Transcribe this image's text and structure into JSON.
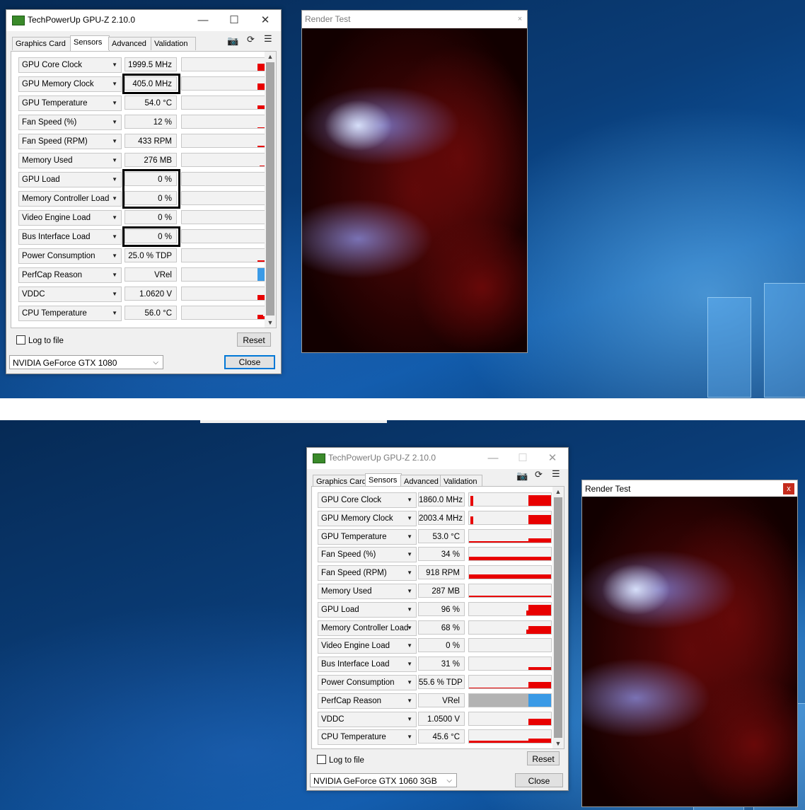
{
  "colors": {
    "graph_bar": "#e80000",
    "perfcap_vrel": "#3a9ae6",
    "perfcap_idle": "#b3b3b3",
    "highlight": "#000000"
  },
  "top": {
    "window_title": "TechPowerUp GPU-Z 2.10.0",
    "tabs": [
      "Graphics Card",
      "Sensors",
      "Advanced",
      "Validation"
    ],
    "active_tab": "Sensors",
    "sensors": [
      {
        "name": "GPU Core Clock",
        "value": "1999.5 MHz"
      },
      {
        "name": "GPU Memory Clock",
        "value": "405.0 MHz"
      },
      {
        "name": "GPU Temperature",
        "value": "54.0 °C"
      },
      {
        "name": "Fan Speed (%)",
        "value": "12 %"
      },
      {
        "name": "Fan Speed (RPM)",
        "value": "433 RPM"
      },
      {
        "name": "Memory Used",
        "value": "276 MB"
      },
      {
        "name": "GPU Load",
        "value": "0 %"
      },
      {
        "name": "Memory Controller Load",
        "value": "0 %"
      },
      {
        "name": "Video Engine Load",
        "value": "0 %"
      },
      {
        "name": "Bus Interface Load",
        "value": "0 %"
      },
      {
        "name": "Power Consumption",
        "value": "25.0 % TDP"
      },
      {
        "name": "PerfCap Reason",
        "value": "VRel"
      },
      {
        "name": "VDDC",
        "value": "1.0620 V"
      },
      {
        "name": "CPU Temperature",
        "value": "56.0 °C"
      }
    ],
    "log_to_file": "Log to file",
    "reset": "Reset",
    "gpu_select": "NVIDIA GeForce GTX 1080",
    "close": "Close",
    "render_title": "Render Test",
    "render_close": "×"
  },
  "bottom": {
    "window_title": "TechPowerUp GPU-Z 2.10.0",
    "tabs": [
      "Graphics Card",
      "Sensors",
      "Advanced",
      "Validation"
    ],
    "active_tab": "Sensors",
    "sensors": [
      {
        "name": "GPU Core Clock",
        "value": "1860.0 MHz"
      },
      {
        "name": "GPU Memory Clock",
        "value": "2003.4 MHz"
      },
      {
        "name": "GPU Temperature",
        "value": "53.0 °C"
      },
      {
        "name": "Fan Speed (%)",
        "value": "34 %"
      },
      {
        "name": "Fan Speed (RPM)",
        "value": "918 RPM"
      },
      {
        "name": "Memory Used",
        "value": "287 MB"
      },
      {
        "name": "GPU Load",
        "value": "96 %"
      },
      {
        "name": "Memory Controller Load",
        "value": "68 %"
      },
      {
        "name": "Video Engine Load",
        "value": "0 %"
      },
      {
        "name": "Bus Interface Load",
        "value": "31 %"
      },
      {
        "name": "Power Consumption",
        "value": "55.6 % TDP"
      },
      {
        "name": "PerfCap Reason",
        "value": "VRel"
      },
      {
        "name": "VDDC",
        "value": "1.0500 V"
      },
      {
        "name": "CPU Temperature",
        "value": "45.6 °C"
      }
    ],
    "log_to_file": "Log to file",
    "reset": "Reset",
    "gpu_select": "NVIDIA GeForce GTX 1060 3GB",
    "close": "Close",
    "render_title": "Render Test",
    "render_close": "x"
  }
}
